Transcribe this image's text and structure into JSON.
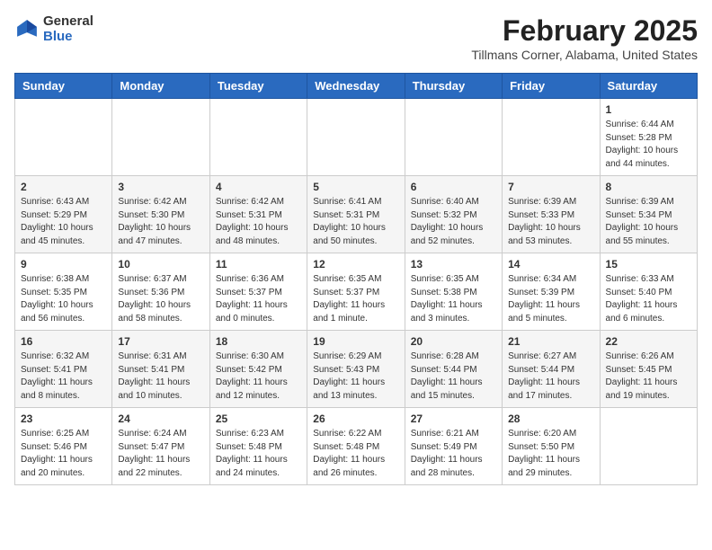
{
  "header": {
    "logo_general": "General",
    "logo_blue": "Blue",
    "month_title": "February 2025",
    "location": "Tillmans Corner, Alabama, United States"
  },
  "weekdays": [
    "Sunday",
    "Monday",
    "Tuesday",
    "Wednesday",
    "Thursday",
    "Friday",
    "Saturday"
  ],
  "weeks": [
    [
      {
        "day": "",
        "content": ""
      },
      {
        "day": "",
        "content": ""
      },
      {
        "day": "",
        "content": ""
      },
      {
        "day": "",
        "content": ""
      },
      {
        "day": "",
        "content": ""
      },
      {
        "day": "",
        "content": ""
      },
      {
        "day": "1",
        "content": "Sunrise: 6:44 AM\nSunset: 5:28 PM\nDaylight: 10 hours\nand 44 minutes."
      }
    ],
    [
      {
        "day": "2",
        "content": "Sunrise: 6:43 AM\nSunset: 5:29 PM\nDaylight: 10 hours\nand 45 minutes."
      },
      {
        "day": "3",
        "content": "Sunrise: 6:42 AM\nSunset: 5:30 PM\nDaylight: 10 hours\nand 47 minutes."
      },
      {
        "day": "4",
        "content": "Sunrise: 6:42 AM\nSunset: 5:31 PM\nDaylight: 10 hours\nand 48 minutes."
      },
      {
        "day": "5",
        "content": "Sunrise: 6:41 AM\nSunset: 5:31 PM\nDaylight: 10 hours\nand 50 minutes."
      },
      {
        "day": "6",
        "content": "Sunrise: 6:40 AM\nSunset: 5:32 PM\nDaylight: 10 hours\nand 52 minutes."
      },
      {
        "day": "7",
        "content": "Sunrise: 6:39 AM\nSunset: 5:33 PM\nDaylight: 10 hours\nand 53 minutes."
      },
      {
        "day": "8",
        "content": "Sunrise: 6:39 AM\nSunset: 5:34 PM\nDaylight: 10 hours\nand 55 minutes."
      }
    ],
    [
      {
        "day": "9",
        "content": "Sunrise: 6:38 AM\nSunset: 5:35 PM\nDaylight: 10 hours\nand 56 minutes."
      },
      {
        "day": "10",
        "content": "Sunrise: 6:37 AM\nSunset: 5:36 PM\nDaylight: 10 hours\nand 58 minutes."
      },
      {
        "day": "11",
        "content": "Sunrise: 6:36 AM\nSunset: 5:37 PM\nDaylight: 11 hours\nand 0 minutes."
      },
      {
        "day": "12",
        "content": "Sunrise: 6:35 AM\nSunset: 5:37 PM\nDaylight: 11 hours\nand 1 minute."
      },
      {
        "day": "13",
        "content": "Sunrise: 6:35 AM\nSunset: 5:38 PM\nDaylight: 11 hours\nand 3 minutes."
      },
      {
        "day": "14",
        "content": "Sunrise: 6:34 AM\nSunset: 5:39 PM\nDaylight: 11 hours\nand 5 minutes."
      },
      {
        "day": "15",
        "content": "Sunrise: 6:33 AM\nSunset: 5:40 PM\nDaylight: 11 hours\nand 6 minutes."
      }
    ],
    [
      {
        "day": "16",
        "content": "Sunrise: 6:32 AM\nSunset: 5:41 PM\nDaylight: 11 hours\nand 8 minutes."
      },
      {
        "day": "17",
        "content": "Sunrise: 6:31 AM\nSunset: 5:41 PM\nDaylight: 11 hours\nand 10 minutes."
      },
      {
        "day": "18",
        "content": "Sunrise: 6:30 AM\nSunset: 5:42 PM\nDaylight: 11 hours\nand 12 minutes."
      },
      {
        "day": "19",
        "content": "Sunrise: 6:29 AM\nSunset: 5:43 PM\nDaylight: 11 hours\nand 13 minutes."
      },
      {
        "day": "20",
        "content": "Sunrise: 6:28 AM\nSunset: 5:44 PM\nDaylight: 11 hours\nand 15 minutes."
      },
      {
        "day": "21",
        "content": "Sunrise: 6:27 AM\nSunset: 5:44 PM\nDaylight: 11 hours\nand 17 minutes."
      },
      {
        "day": "22",
        "content": "Sunrise: 6:26 AM\nSunset: 5:45 PM\nDaylight: 11 hours\nand 19 minutes."
      }
    ],
    [
      {
        "day": "23",
        "content": "Sunrise: 6:25 AM\nSunset: 5:46 PM\nDaylight: 11 hours\nand 20 minutes."
      },
      {
        "day": "24",
        "content": "Sunrise: 6:24 AM\nSunset: 5:47 PM\nDaylight: 11 hours\nand 22 minutes."
      },
      {
        "day": "25",
        "content": "Sunrise: 6:23 AM\nSunset: 5:48 PM\nDaylight: 11 hours\nand 24 minutes."
      },
      {
        "day": "26",
        "content": "Sunrise: 6:22 AM\nSunset: 5:48 PM\nDaylight: 11 hours\nand 26 minutes."
      },
      {
        "day": "27",
        "content": "Sunrise: 6:21 AM\nSunset: 5:49 PM\nDaylight: 11 hours\nand 28 minutes."
      },
      {
        "day": "28",
        "content": "Sunrise: 6:20 AM\nSunset: 5:50 PM\nDaylight: 11 hours\nand 29 minutes."
      },
      {
        "day": "",
        "content": ""
      }
    ]
  ]
}
